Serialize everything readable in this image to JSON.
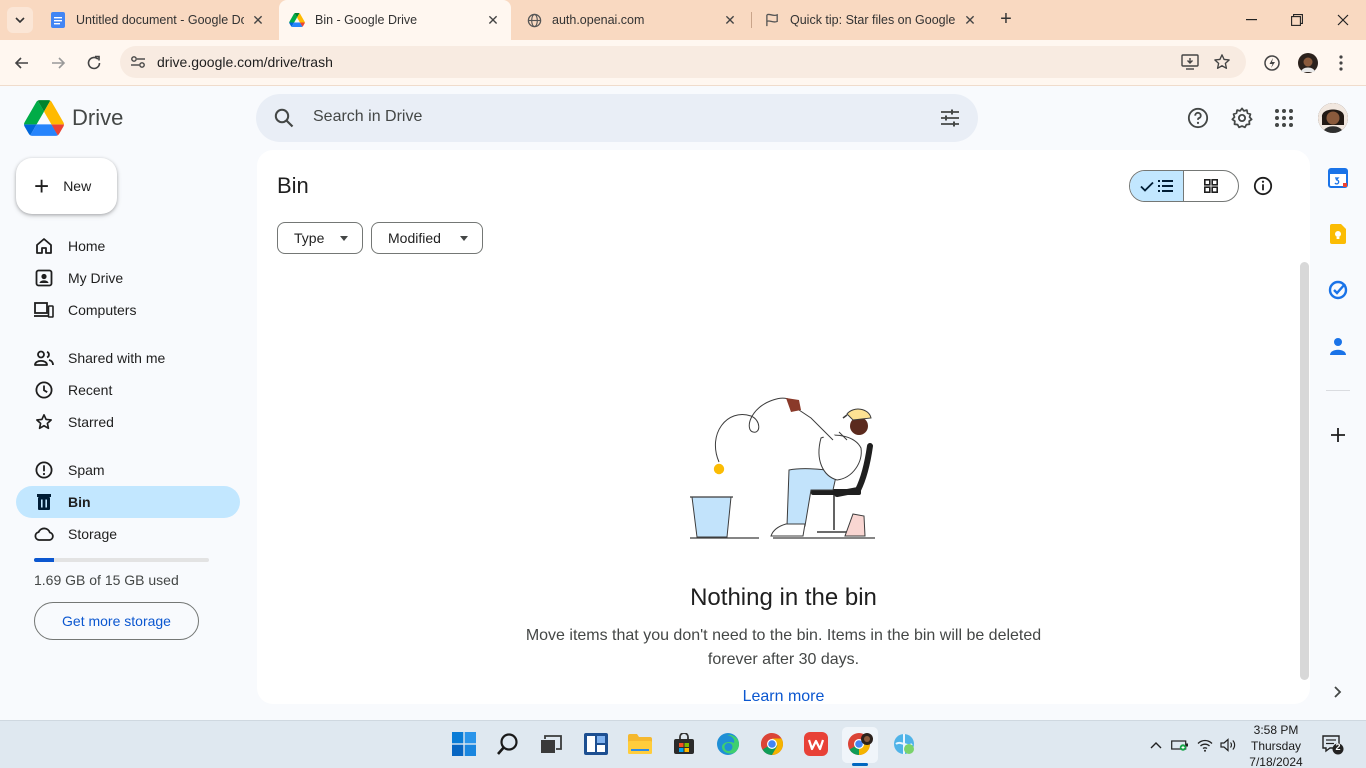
{
  "browser": {
    "tabs": [
      {
        "title": "Untitled document - Google Do",
        "icon": "docs-icon",
        "active": false
      },
      {
        "title": "Bin - Google Drive",
        "icon": "drive-icon",
        "active": true
      },
      {
        "title": "auth.openai.com",
        "icon": "globe-icon",
        "active": false
      },
      {
        "title": "Quick tip: Star files on Google D",
        "icon": "flag-icon",
        "active": false
      }
    ],
    "url": "drive.google.com/drive/trash"
  },
  "header": {
    "app_name": "Drive",
    "search_placeholder": "Search in Drive"
  },
  "sidebar": {
    "new_label": "New",
    "items": [
      {
        "label": "Home",
        "icon": "home-icon"
      },
      {
        "label": "My Drive",
        "icon": "my-drive-icon"
      },
      {
        "label": "Computers",
        "icon": "computers-icon"
      },
      {
        "label": "Shared with me",
        "icon": "shared-icon"
      },
      {
        "label": "Recent",
        "icon": "clock-icon"
      },
      {
        "label": "Starred",
        "icon": "star-icon"
      },
      {
        "label": "Spam",
        "icon": "spam-icon"
      },
      {
        "label": "Bin",
        "icon": "bin-icon",
        "active": true
      },
      {
        "label": "Storage",
        "icon": "cloud-icon"
      }
    ],
    "storage_text": "1.69 GB of 15 GB used",
    "storage_used_fraction": 0.113,
    "get_more_storage": "Get more storage"
  },
  "main": {
    "title": "Bin",
    "filters": [
      "Type",
      "Modified"
    ],
    "empty_title": "Nothing in the bin",
    "empty_desc": "Move items that you don't need to the bin. Items in the bin will be deleted forever after 30 days.",
    "learn_more": "Learn more"
  },
  "taskbar": {
    "time": "3:58 PM",
    "day": "Thursday",
    "date": "7/18/2024",
    "notification_count": "2"
  },
  "colors": {
    "accent": "#0b57d0",
    "active_nav": "#c2e7ff",
    "tabstrip": "#f9d9c1"
  }
}
